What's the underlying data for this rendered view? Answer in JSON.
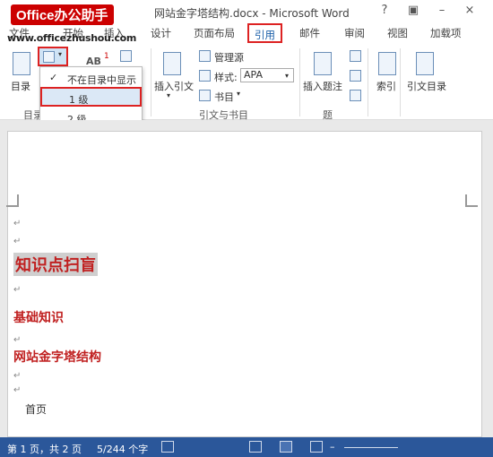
{
  "watermark": {
    "logo": "Office办公助手",
    "site": "www.officezhushou.com"
  },
  "window": {
    "title": "网站金字塔结构.docx - Microsoft Word",
    "help": "?",
    "restore": "▣",
    "minimize": "–",
    "close": "×"
  },
  "tabs": [
    {
      "label": "文件"
    },
    {
      "label": "开始"
    },
    {
      "label": "插入"
    },
    {
      "label": "设计"
    },
    {
      "label": "页面布局"
    },
    {
      "label": "引用"
    },
    {
      "label": "邮件"
    },
    {
      "label": "审阅"
    },
    {
      "label": "视图"
    },
    {
      "label": "加载项"
    }
  ],
  "ribbon": {
    "toc": "目录",
    "toc_group": "目录",
    "insert_citation": "插入引文",
    "manage_sources": "管理源",
    "style_label": "样式:",
    "style_value": "APA",
    "bibliography": "书目",
    "citations_group": "引文与书目",
    "insert_caption": "插入题注",
    "captions_group": "题",
    "index": "索引",
    "toa": "引文目录",
    "footnote_badge": "AB",
    "footnote_sup": "1"
  },
  "menu": {
    "items": [
      "不在目录中显示",
      "1 级",
      "2 级",
      "3 级"
    ]
  },
  "document": {
    "heading1": "知识点扫盲",
    "heading2a": "基础知识",
    "heading2b": "网站金字塔结构",
    "body": "首页",
    "para_mark": "↵"
  },
  "status": {
    "page": "第 1 页，共 2 页",
    "words": "5/244 个字"
  },
  "colors": {
    "accent": "#2b579a",
    "highlight": "#d22222",
    "heading": "#c02020"
  }
}
